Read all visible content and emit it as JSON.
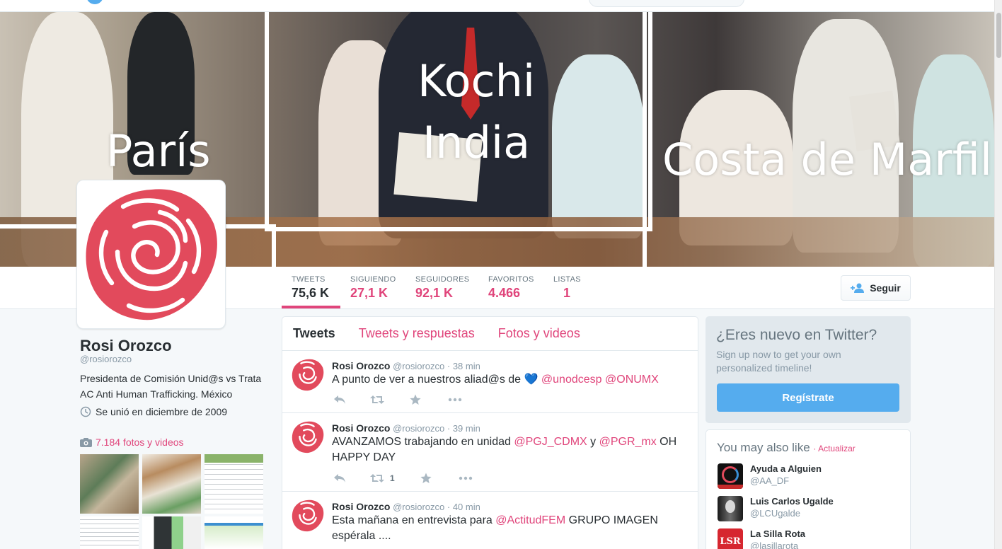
{
  "header": {
    "captions": [
      "París",
      "Kochi\nIndia",
      "Costa de Marfil"
    ],
    "caption_partial": "a"
  },
  "profile": {
    "name": "Rosi Orozco",
    "handle": "@rosiorozco",
    "bio": "Presidenta de Comisión Unid@s vs Trata AC Anti Human Trafficking. México",
    "joined": "Se unió en diciembre de 2009",
    "media": "7.184 fotos y videos"
  },
  "stats": [
    {
      "label": "TWEETS",
      "value": "75,6 K"
    },
    {
      "label": "SIGUIENDO",
      "value": "27,1 K"
    },
    {
      "label": "SEGUIDORES",
      "value": "92,1 K"
    },
    {
      "label": "FAVORITOS",
      "value": "4.466"
    },
    {
      "label": "LISTAS",
      "value": "1"
    }
  ],
  "follow_label": "Seguir",
  "tabs": [
    "Tweets",
    "Tweets y respuestas",
    "Fotos y videos"
  ],
  "tweets": [
    {
      "name": "Rosi Orozco",
      "handle": "@rosiorozco",
      "time": "· 38 min",
      "text_pre": "A punto de ver a nuestros aliad@s de ",
      "heart": "💙",
      "mention1": "@unodcesp",
      "mention2": "@ONUMX",
      "retweets": ""
    },
    {
      "name": "Rosi Orozco",
      "handle": "@rosiorozco",
      "time": "· 39 min",
      "text_pre": "AVANZAMOS trabajando en unidad ",
      "mention1": "@PGJ_CDMX",
      "mid": " y ",
      "mention2": "@PGR_mx",
      "text_post": " OH HAPPY DAY",
      "retweets": "1"
    },
    {
      "name": "Rosi Orozco",
      "handle": "@rosiorozco",
      "time": "· 40 min",
      "text_pre": "Esta mañana en entrevista para ",
      "mention1": "@ActitudFEM",
      "text_post": " GRUPO IMAGEN espérala ...."
    }
  ],
  "signup": {
    "title": "¿Eres nuevo en Twitter?",
    "text": "Sign up now to get your own personalized timeline!",
    "button": "Regístrate"
  },
  "suggestions": {
    "title": "You may also like",
    "refresh": "Actualizar",
    "items": [
      {
        "name": "Ayuda a Alguien",
        "handle": "@AA_DF"
      },
      {
        "name": "Luis Carlos Ugalde",
        "handle": "@LCUgalde"
      },
      {
        "name": "La Silla Rota",
        "handle": "@lasillarota",
        "logo_text": "LSR"
      }
    ]
  },
  "colors": {
    "accent": "#e0457b",
    "twitter_blue": "#55acee",
    "rose": "#e24a5c"
  }
}
